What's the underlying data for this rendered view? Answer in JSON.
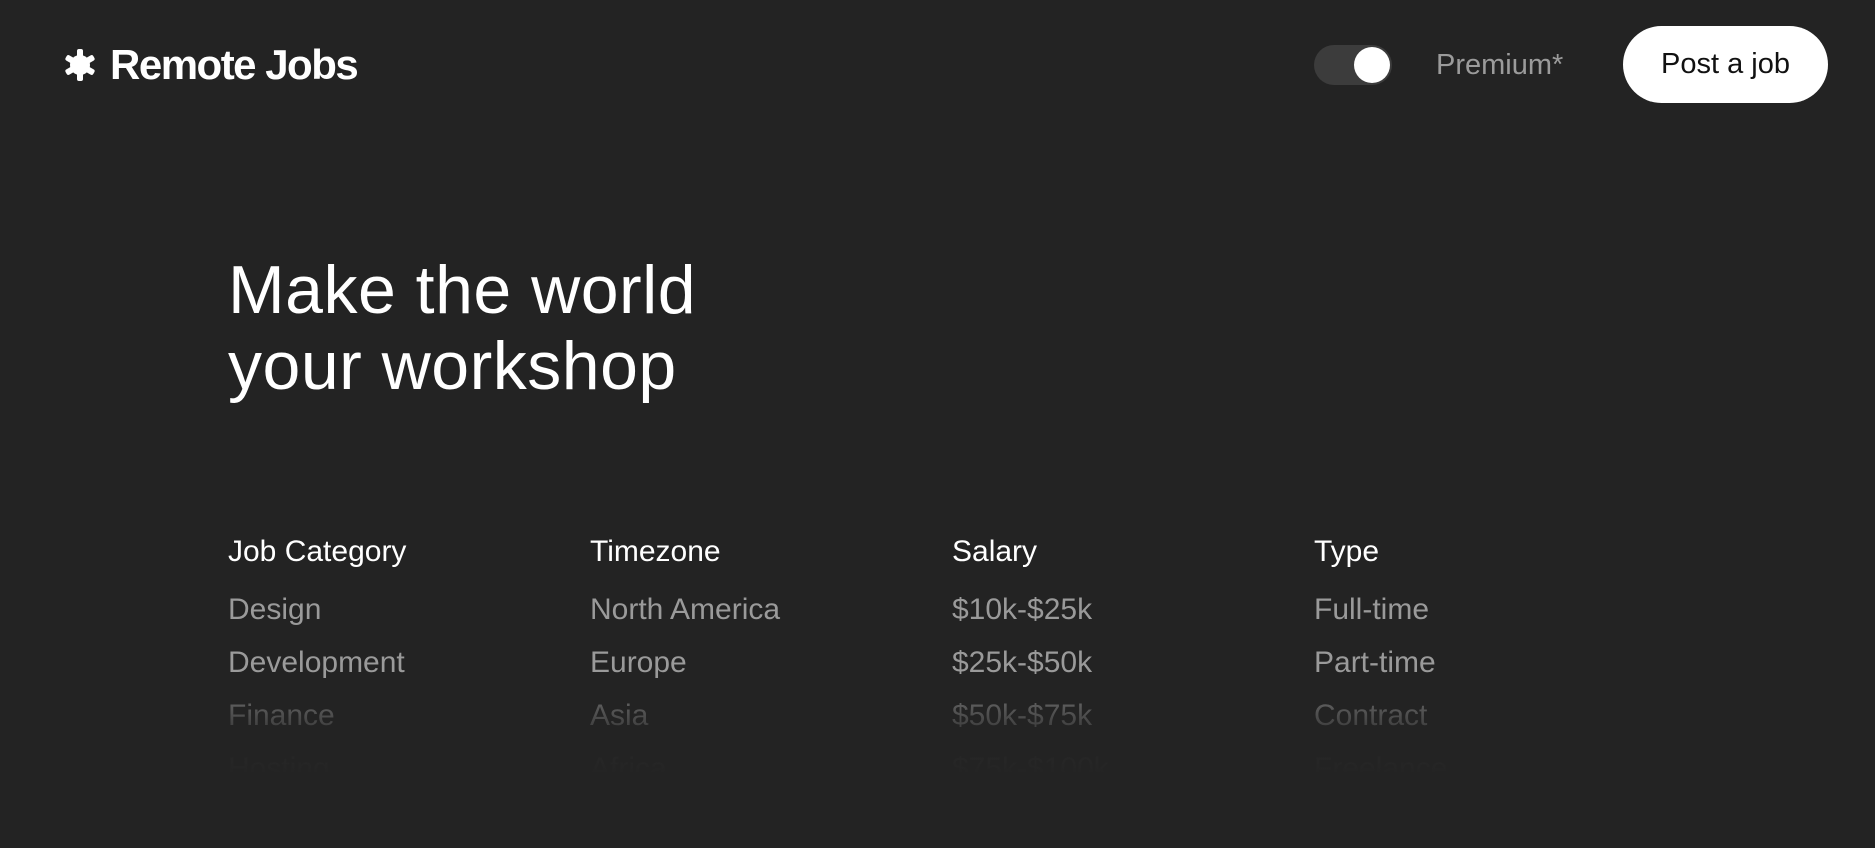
{
  "header": {
    "logo_text": "Remote Jobs",
    "logo_icon": "star-burst-icon",
    "premium_label": "Premium*",
    "premium_toggle_on": true,
    "post_job_label": "Post a job"
  },
  "hero": {
    "title_line1": "Make the world",
    "title_line2": "your workshop"
  },
  "filters": [
    {
      "heading": "Job Category",
      "items": [
        "Design",
        "Development",
        "Finance",
        "Hosting"
      ]
    },
    {
      "heading": "Timezone",
      "items": [
        "North America",
        "Europe",
        "Asia",
        "Africa"
      ]
    },
    {
      "heading": "Salary",
      "items": [
        "$10k-$25k",
        "$25k-$50k",
        "$50k-$75k",
        "$75k-$100k"
      ]
    },
    {
      "heading": "Type",
      "items": [
        "Full-time",
        "Part-time",
        "Contract",
        "Freelance"
      ]
    }
  ],
  "colors": {
    "background": "#232323",
    "text_primary": "#ffffff",
    "text_muted": "#9a9a9a",
    "button_bg": "#ffffff"
  }
}
